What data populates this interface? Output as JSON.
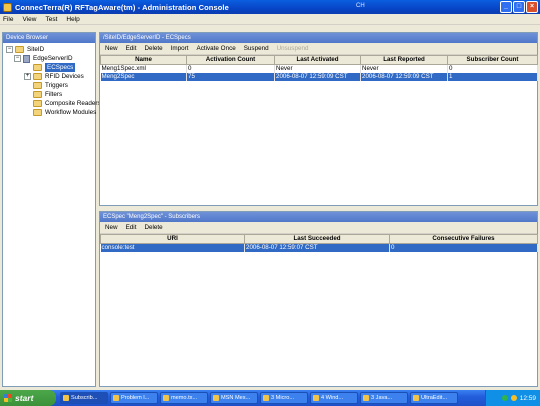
{
  "window": {
    "title": "ConnecTerra(R) RFTagAware(tm) - Administration Console",
    "mid_text": "CH"
  },
  "menu": [
    "File",
    "View",
    "Test",
    "Help"
  ],
  "device_browser": {
    "title": "Device Browser",
    "tree": [
      {
        "label": "SiteID",
        "expander": "−",
        "level": 0
      },
      {
        "label": "EdgeServerID",
        "expander": "−",
        "level": 1
      },
      {
        "label": "ECSpecs",
        "expander": "",
        "level": 2,
        "selected": true
      },
      {
        "label": "RFID Devices",
        "expander": "+",
        "level": 2
      },
      {
        "label": "Triggers",
        "expander": "",
        "level": 2
      },
      {
        "label": "Filters",
        "expander": "",
        "level": 2
      },
      {
        "label": "Composite Readers",
        "expander": "",
        "level": 2
      },
      {
        "label": "Workflow Modules",
        "expander": "",
        "level": 2
      }
    ]
  },
  "ecspecs_panel": {
    "title": "/SiteID/EdgeServerID - ECSpecs",
    "toolbar": {
      "new": "New",
      "edit": "Edit",
      "delete": "Delete",
      "import": "Import",
      "activate_once": "Activate Once",
      "suspend": "Suspend",
      "unsuspend": "Unsuspend"
    },
    "columns": [
      "Name",
      "Activation Count",
      "Last Activated",
      "Last Reported",
      "Subscriber Count"
    ],
    "rows": [
      [
        "Meng1Spec.xml",
        "0",
        "Never",
        "Never",
        "0"
      ],
      [
        "Meng2Spec",
        "75",
        "2006-08-07 12:59:09 CST",
        "2006-08-07 12:59:09 CST",
        "1"
      ]
    ]
  },
  "subscribers_panel": {
    "title": "ECSpec \"Meng2Spec\" - Subscribers",
    "toolbar": {
      "new": "New",
      "edit": "Edit",
      "delete": "Delete"
    },
    "columns": [
      "URI",
      "Last Succeeded",
      "Consecutive Failures"
    ],
    "rows": [
      [
        "console:test",
        "2006-08-07 12:59:07 CST",
        "0"
      ]
    ]
  },
  "taskbar": {
    "start": "start",
    "tasks": [
      "Subscrib...",
      "Problem l...",
      "memo.tx...",
      "MSN Mes...",
      "3 Micro...",
      "4 Wind...",
      "3 Java...",
      "UltraEdit..."
    ],
    "clock": "12:59"
  }
}
